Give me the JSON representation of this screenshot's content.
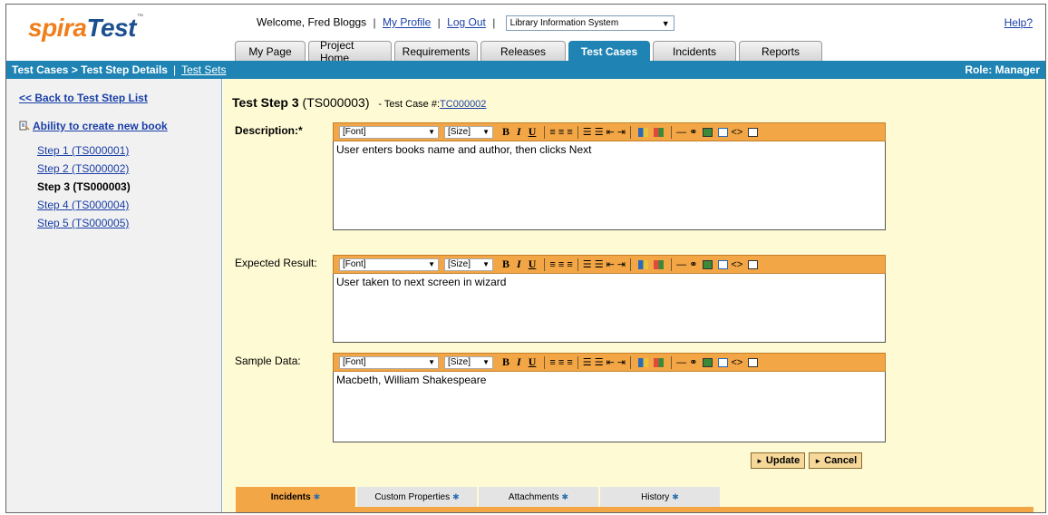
{
  "app": {
    "logo_part1": "spira",
    "logo_part2": "Test",
    "logo_tm": "™"
  },
  "topbar": {
    "welcome": "Welcome, Fred Bloggs",
    "my_profile": "My Profile",
    "log_out": "Log Out",
    "project": "Library Information System",
    "help": "Help?"
  },
  "tabs": [
    {
      "label": "My Page"
    },
    {
      "label": "Project Home"
    },
    {
      "label": "Requirements"
    },
    {
      "label": "Releases"
    },
    {
      "label": "Test Cases",
      "active": true
    },
    {
      "label": "Incidents"
    },
    {
      "label": "Reports"
    }
  ],
  "navbar": {
    "breadcrumb": "Test Cases > Test Step Details",
    "test_sets": "Test Sets",
    "role": "Role: Manager"
  },
  "sidebar": {
    "back_link": "<< Back to Test Step List",
    "test_case_title": "Ability to create new book",
    "steps": [
      {
        "label": "Step 1 (TS000001)",
        "current": false
      },
      {
        "label": "Step 2 (TS000002)",
        "current": false
      },
      {
        "label": "Step 3 (TS000003)",
        "current": true
      },
      {
        "label": "Step 4 (TS000004)",
        "current": false
      },
      {
        "label": "Step 5 (TS000005)",
        "current": false
      }
    ]
  },
  "main": {
    "step_title": "Test Step 3",
    "step_id": "(TS000003)",
    "test_case_prefix": "- Test Case #:",
    "test_case_link": "TC000002",
    "fields": {
      "description": {
        "label": "Description:*",
        "value": "User enters books name and author, then clicks Next"
      },
      "expected": {
        "label": "Expected Result:",
        "value": "User taken to next screen in wizard"
      },
      "sample": {
        "label": "Sample Data:",
        "value": "Macbeth, William Shakespeare"
      }
    },
    "toolbar": {
      "font": "[Font]",
      "size": "[Size]",
      "bold": "B",
      "italic": "I",
      "underline": "U"
    },
    "buttons": {
      "update": "Update",
      "cancel": "Cancel"
    },
    "bottom_tabs": [
      {
        "label": "Incidents",
        "active": true
      },
      {
        "label": "Custom Properties",
        "active": false
      },
      {
        "label": "Attachments",
        "active": false
      },
      {
        "label": "History",
        "active": false
      }
    ]
  },
  "colors": {
    "nav_blue": "#1f84b4",
    "toolbar_orange": "#f3a646",
    "content_bg": "#fefad4",
    "logo_orange": "#f07e1b",
    "logo_blue": "#1b4f8f"
  }
}
